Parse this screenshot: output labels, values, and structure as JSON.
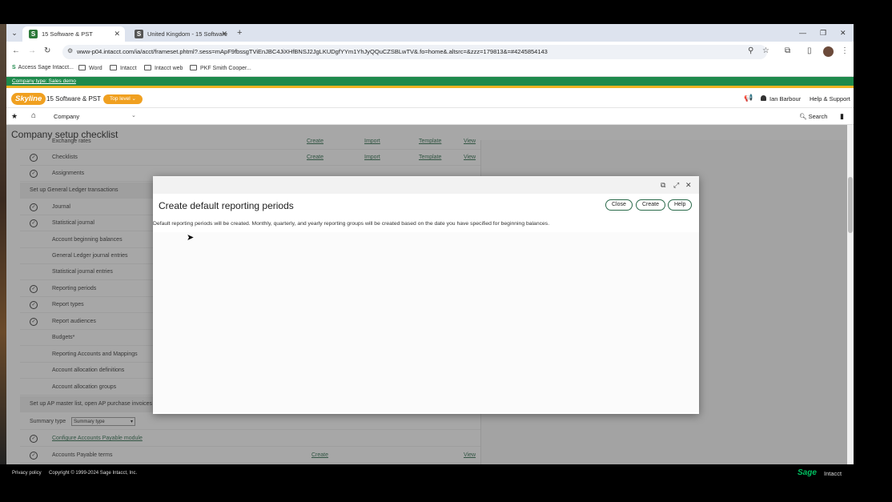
{
  "browser": {
    "tabs": [
      {
        "title": "15 Software & PST",
        "favicon": "S"
      },
      {
        "title": "United Kingdom - 15 Software",
        "favicon": "S"
      }
    ],
    "url": "www-p04.intacct.com/ia/acct/frameset.phtml?.sess=mApF9fbssgTViEnJBC4JiXHfBNSJ2JgLKUDgfYYm1YhJyQQuCZSBLwTV&.fo=home&.altsrc=&zzz=179813&=#4245854143",
    "bookmarks": [
      "Access Sage Intacct...",
      "Word",
      "Intacct",
      "Intacct web",
      "PKF Smith Cooper..."
    ]
  },
  "company_type_bar": "Company type: Sales demo",
  "header": {
    "logo": "Skyline",
    "company": "15 Software & PST",
    "level": "Top level",
    "user": "Ian Barbour",
    "help": "Help & Support"
  },
  "menu": {
    "company": "Company",
    "search": "Search"
  },
  "page": {
    "title": "Company setup checklist",
    "rows": [
      {
        "label": "Exchange rates",
        "actions": [
          "Create",
          "Import",
          "Template",
          "View"
        ],
        "checked": false
      },
      {
        "label": "Checklists",
        "actions": [
          "Create",
          "Import",
          "Template",
          "View"
        ],
        "checked": true
      },
      {
        "label": "Assignments",
        "actions": [],
        "checked": true
      },
      {
        "label": "Set up General Ledger transactions",
        "section": true
      },
      {
        "label": "Journal",
        "checked": true
      },
      {
        "label": "Statistical journal",
        "checked": true
      },
      {
        "label": "Account beginning balances",
        "checked": false
      },
      {
        "label": "General Ledger journal entries",
        "checked": false
      },
      {
        "label": "Statistical journal entries",
        "checked": false
      },
      {
        "label": "Reporting periods",
        "checked": true
      },
      {
        "label": "Report types",
        "checked": true
      },
      {
        "label": "Report audiences",
        "checked": true
      },
      {
        "label": "Budgets*",
        "checked": false
      },
      {
        "label": "Reporting Accounts and Mappings",
        "checked": false
      },
      {
        "label": "Account allocation definitions",
        "checked": false
      },
      {
        "label": "Account allocation groups",
        "checked": false
      },
      {
        "label": "Set up AP master list, open AP purchase invoices",
        "section": true
      },
      {
        "label": "Summary type",
        "select": "Summary type"
      },
      {
        "label": "Configure Accounts Payable module",
        "checked": true,
        "link": true
      },
      {
        "label": "Accounts Payable terms",
        "checked": true,
        "actions": [
          "Create",
          "View"
        ]
      }
    ]
  },
  "modal": {
    "title": "Create default reporting periods",
    "buttons": {
      "close": "Close",
      "create": "Create",
      "help": "Help"
    },
    "message": "Default reporting periods will be created. Monthly, quarterly, and yearly reporting groups will be created based on the date you have specified for beginning balances."
  },
  "footer": {
    "privacy": "Privacy policy",
    "copyright": "Copyright © 1999-2024 Sage Intacct, Inc.",
    "brand_sage": "Sage",
    "brand_intacct": "Intacct"
  },
  "colors": {
    "accent_green": "#1e8a4c",
    "accent_orange": "#f0a020"
  }
}
